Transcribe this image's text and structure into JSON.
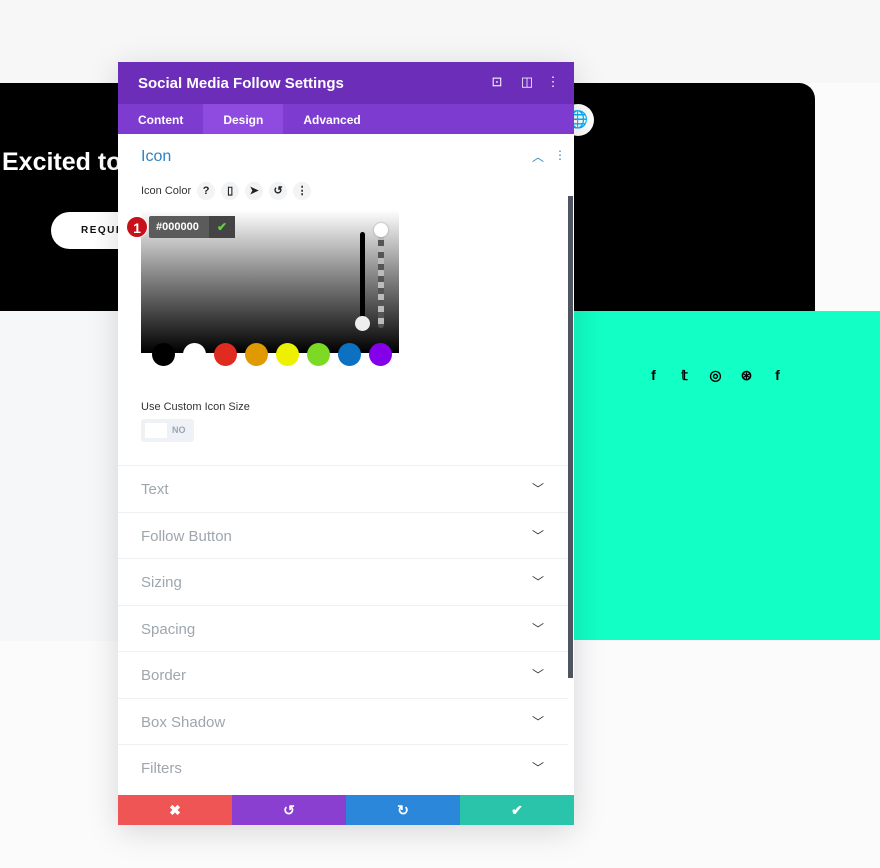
{
  "page": {
    "hero_title": "Excited to",
    "hero_button": "REQUES"
  },
  "social_icons": [
    "facebook-icon",
    "twitter-icon",
    "instagram-icon",
    "dribbble-icon",
    "facebook-icon"
  ],
  "panel": {
    "title": "Social Media Follow Settings",
    "tabs": [
      {
        "label": "Content"
      },
      {
        "label": "Design"
      },
      {
        "label": "Advanced"
      }
    ],
    "active_tab": "Design",
    "section": {
      "title": "Icon",
      "icon_color_label": "Icon Color",
      "color_value": "#000000",
      "badge": "1",
      "swatches": [
        "#000000",
        "#ffffff",
        "#e02b20",
        "#e09900",
        "#edf000",
        "#7cda24",
        "#0c71c3",
        "#8300e9"
      ],
      "custom_size_label": "Use Custom Icon Size",
      "toggle_value": "NO"
    },
    "groups": [
      {
        "label": "Text"
      },
      {
        "label": "Follow Button"
      },
      {
        "label": "Sizing"
      },
      {
        "label": "Spacing"
      },
      {
        "label": "Border"
      },
      {
        "label": "Box Shadow"
      },
      {
        "label": "Filters"
      }
    ]
  },
  "colors": {
    "header": "#6c2eb9",
    "tabs": "#7e3bd0",
    "accent": "#2e83c4",
    "cancel": "#ef5555",
    "undo": "#8a3fd1",
    "redo": "#2b87da",
    "save": "#29c4a9",
    "mint": "#12ffc5"
  }
}
